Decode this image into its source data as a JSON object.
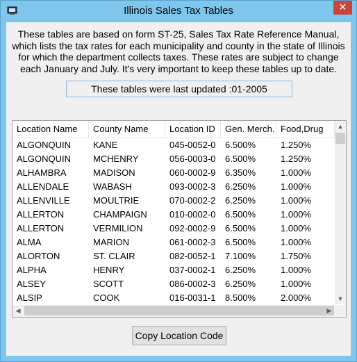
{
  "window": {
    "title": "Illinois Sales Tax Tables",
    "close_label": "✕"
  },
  "description": "These tables are based on form ST-25, Sales Tax Rate Reference Manual, which lists the tax rates for each municipality and county in the state of Illinois for which the department collects taxes. These rates are subject to change each January and July. It's very important to keep these tables up to date.",
  "last_updated": "These tables were last updated :01-2005",
  "table": {
    "columns": [
      "Location Name",
      "County Name",
      "Location ID",
      "Gen. Merch.",
      "Food,Drug"
    ],
    "rows": [
      {
        "location": "ALGONQUIN",
        "county": "KANE",
        "id": "045-0052-0",
        "gen": "6.500%",
        "food": "1.250%"
      },
      {
        "location": "ALGONQUIN",
        "county": "MCHENRY",
        "id": "056-0003-0",
        "gen": "6.500%",
        "food": "1.250%"
      },
      {
        "location": "ALHAMBRA",
        "county": "MADISON",
        "id": "060-0002-9",
        "gen": "6.350%",
        "food": "1.000%"
      },
      {
        "location": "ALLENDALE",
        "county": "WABASH",
        "id": "093-0002-3",
        "gen": "6.250%",
        "food": "1.000%"
      },
      {
        "location": "ALLENVILLE",
        "county": "MOULTRIE",
        "id": "070-0002-2",
        "gen": "6.250%",
        "food": "1.000%"
      },
      {
        "location": "ALLERTON",
        "county": "CHAMPAIGN",
        "id": "010-0002-0",
        "gen": "6.500%",
        "food": "1.000%"
      },
      {
        "location": "ALLERTON",
        "county": "VERMILION",
        "id": "092-0002-9",
        "gen": "6.500%",
        "food": "1.000%"
      },
      {
        "location": "ALMA",
        "county": "MARION",
        "id": "061-0002-3",
        "gen": "6.500%",
        "food": "1.000%"
      },
      {
        "location": "ALORTON",
        "county": "ST. CLAIR",
        "id": "082-0052-1",
        "gen": "7.100%",
        "food": "1.750%"
      },
      {
        "location": "ALPHA",
        "county": "HENRY",
        "id": "037-0002-1",
        "gen": "6.250%",
        "food": "1.000%"
      },
      {
        "location": "ALSEY",
        "county": "SCOTT",
        "id": "086-0002-3",
        "gen": "6.250%",
        "food": "1.000%"
      },
      {
        "location": "ALSIP",
        "county": "COOK",
        "id": "016-0031-1",
        "gen": "8.500%",
        "food": "2.000%"
      }
    ]
  },
  "copy_button": "Copy Location Code",
  "icons": {
    "app": "app-icon",
    "scroll_up": "scroll-up-icon",
    "scroll_down": "scroll-down-icon",
    "scroll_left": "scroll-left-icon",
    "scroll_right": "scroll-right-icon"
  }
}
